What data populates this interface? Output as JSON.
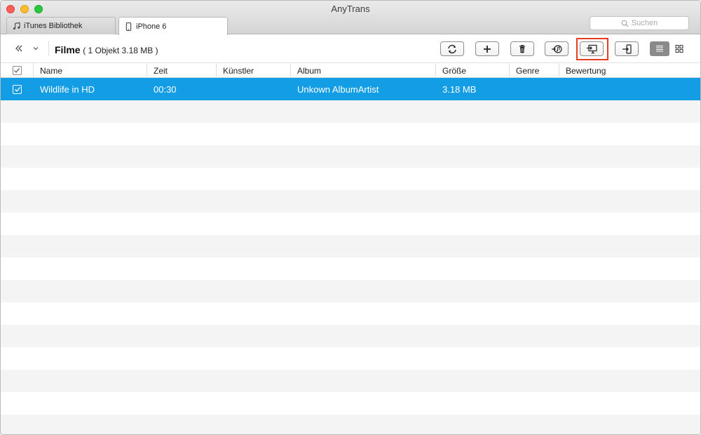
{
  "window": {
    "title": "AnyTrans"
  },
  "tabs": [
    {
      "label": "iTunes Bibliothek",
      "icon": "music-note-icon"
    },
    {
      "label": "iPhone 6",
      "icon": "iphone-icon"
    }
  ],
  "search": {
    "placeholder": "Suchen"
  },
  "breadcrumb": {
    "title": "Filme",
    "meta": "( 1 Objekt  3.18 MB )"
  },
  "toolbar": {
    "buttons": [
      {
        "name": "refresh-button",
        "icon": "refresh-icon"
      },
      {
        "name": "add-button",
        "icon": "plus-icon"
      },
      {
        "name": "delete-button",
        "icon": "trash-icon"
      },
      {
        "name": "to-itunes-button",
        "icon": "itunes-transfer-icon"
      },
      {
        "name": "to-computer-button",
        "icon": "monitor-import-icon",
        "highlighted": true
      },
      {
        "name": "to-device-button",
        "icon": "device-import-icon"
      }
    ],
    "view_modes": [
      "list-view-icon",
      "grid-view-icon"
    ]
  },
  "table": {
    "columns": [
      "Name",
      "Zeit",
      "Künstler",
      "Album",
      "Größe",
      "Genre",
      "Bewertung"
    ],
    "rows": [
      {
        "name": "Wildlife in HD",
        "zeit": "00:30",
        "kuenstler": "",
        "album": "Unkown AlbumArtist",
        "groesse": "3.18 MB",
        "genre": "",
        "bewertung": "",
        "selected": true
      }
    ]
  },
  "colors": {
    "selection": "#139de4",
    "highlight": "#e63c22"
  }
}
